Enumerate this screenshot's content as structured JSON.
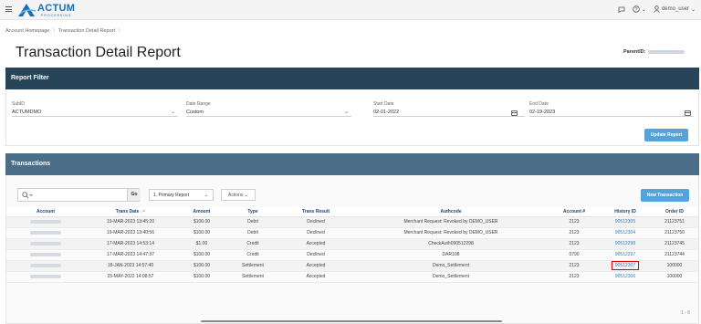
{
  "header": {
    "logo_name": "ACTUM",
    "logo_sub": "PROCESSING",
    "user": "demo_user"
  },
  "breadcrumb": [
    "Account Homepage",
    "Transaction Detail Report"
  ],
  "page": {
    "title": "Transaction Detail Report",
    "parent_id_label": "ParentID:"
  },
  "report_filter": {
    "title": "Report Filter",
    "subid_label": "SubID",
    "subid_value": "ACTUMDMO",
    "date_range_label": "Date Range",
    "date_range_value": "Custom",
    "start_date_label": "Start Date",
    "start_date_value": "02-01-2022",
    "end_date_label": "End Date",
    "end_date_value": "02-19-2023",
    "update_button": "Update Report"
  },
  "transactions": {
    "title": "Transactions",
    "go_label": "Go",
    "report_select": "1. Primary Report",
    "actions_label": "Actions",
    "new_transaction": "New Transaction",
    "columns": [
      "Account",
      "Trans Date",
      "Amount",
      "Type",
      "Trans Result",
      "Authcode",
      "Account #",
      "History ID",
      "Order ID"
    ],
    "sort_indicator": "↓=",
    "rows": [
      {
        "trans_date": "19-MAR-2023 13:45:20",
        "amount": "$100.00",
        "type": "Debit",
        "result": "Declined",
        "authcode": "Merchant Request: Revoked by DEMO_USER",
        "account_no": "2123",
        "history_id": "90512305",
        "order_id": "21123751"
      },
      {
        "trans_date": "19-MAR-2023 13:40:56",
        "amount": "$100.00",
        "type": "Debit",
        "result": "Declined",
        "authcode": "Merchant Request: Revoked by DEMO_USER",
        "account_no": "2123",
        "history_id": "90512304",
        "order_id": "21123750"
      },
      {
        "trans_date": "17-MAR-2023 14:53:14",
        "amount": "$1.00",
        "type": "Credit",
        "result": "Accepted",
        "authcode": "CheckAuth090512298",
        "account_no": "2123",
        "history_id": "90512298",
        "order_id": "21123745"
      },
      {
        "trans_date": "17-MAR-2023 14:47:37",
        "amount": "$100.00",
        "type": "Credit",
        "result": "Declined",
        "authcode": "DAR108",
        "account_no": "0790",
        "history_id": "90512297",
        "order_id": "21123744"
      },
      {
        "trans_date": "18-JAN-2023 14:57:40",
        "amount": "$100.00",
        "type": "Settlement",
        "result": "Accepted",
        "authcode": "Demo_Settlement",
        "account_no": "2123",
        "history_id": "90512307",
        "order_id": "100000"
      },
      {
        "trans_date": "25-MAY-2022 14:08:57",
        "amount": "$100.00",
        "type": "Settlement",
        "result": "Accepted",
        "authcode": "Demo_Settlement",
        "account_no": "2123",
        "history_id": "90512306",
        "order_id": "100000"
      }
    ],
    "pagination": "1 - 6"
  },
  "colors": {
    "filter_header": "#274459",
    "transactions_header": "#4b6e88",
    "button_blue": "#56a3d9",
    "link": "#2f7cc4",
    "highlight": "#e00000"
  }
}
